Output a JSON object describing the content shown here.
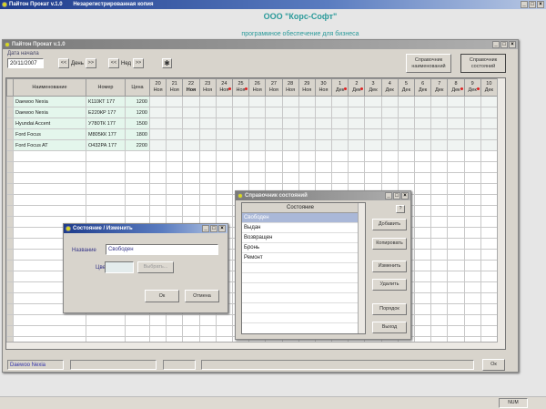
{
  "app": {
    "title": "Пайтон Прокат v.1.0",
    "subtitle": "Незарегистрированная копия"
  },
  "company": {
    "name": "ООО \"Корс-Софт\"",
    "tagline": "программное обеспечение для бизнеса"
  },
  "inner": {
    "title": "Пайтон Прокат v.1.0",
    "date_label": "Дата начала",
    "date_value": "20/11/2007",
    "day_prev": "<<",
    "day_label": "День",
    "day_next": ">>",
    "week_prev": "<<",
    "week_label": "Нед",
    "week_next": ">>",
    "btn_names": "Справочник наименований",
    "btn_states": "Справочник состояний"
  },
  "grid": {
    "headers": [
      "Наименование",
      "Номер",
      "Цена"
    ],
    "days": [
      {
        "d": "20",
        "m": "Ноя"
      },
      {
        "d": "21",
        "m": "Ноя"
      },
      {
        "d": "22",
        "m": "Ноя"
      },
      {
        "d": "23",
        "m": "Ноя"
      },
      {
        "d": "24",
        "m": "Ноя",
        "h": 1
      },
      {
        "d": "25",
        "m": "Ноя",
        "h": 1
      },
      {
        "d": "26",
        "m": "Ноя"
      },
      {
        "d": "27",
        "m": "Ноя"
      },
      {
        "d": "28",
        "m": "Ноя"
      },
      {
        "d": "29",
        "m": "Ноя"
      },
      {
        "d": "30",
        "m": "Ноя"
      },
      {
        "d": "1",
        "m": "Дек",
        "h": 1
      },
      {
        "d": "2",
        "m": "Дек",
        "h": 1
      },
      {
        "d": "3",
        "m": "Дек"
      },
      {
        "d": "4",
        "m": "Дек"
      },
      {
        "d": "5",
        "m": "Дек"
      },
      {
        "d": "6",
        "m": "Дек"
      },
      {
        "d": "7",
        "m": "Дек"
      },
      {
        "d": "8",
        "m": "Дек",
        "h": 1
      },
      {
        "d": "9",
        "m": "Дек",
        "h": 1
      },
      {
        "d": "10",
        "m": "Дек"
      }
    ],
    "rows": [
      [
        "Daewoo Nexia",
        "К110КТ 177",
        "1200"
      ],
      [
        "Daewoo Nexia",
        "Е220КР 177",
        "1200"
      ],
      [
        "Hyundai Accent",
        "У780ТК 177",
        "1500"
      ],
      [
        "Ford Focus",
        "М805КК 177",
        "1800"
      ],
      [
        "Ford Focus AT",
        "О432РА 177",
        "2200"
      ]
    ]
  },
  "status": {
    "selected": "Daewoo Nexia",
    "ok": "Ок",
    "num": "NUM"
  },
  "edit_dialog": {
    "title": "Состояние / Изменить",
    "name_label": "Название",
    "name_value": "Свободен",
    "color_label": "Цвет",
    "choose": "Выбрать...",
    "ok": "Ок",
    "cancel": "Отмена"
  },
  "states_dialog": {
    "title": "Справочник состояний",
    "column": "Состояние",
    "items": [
      "Свободен",
      "Выдан",
      "Возвращен",
      "Бронь",
      "Ремонт"
    ],
    "buttons": [
      "Добавить",
      "Копировать",
      "Изменить",
      "Удалить",
      "Порядок",
      "Выход"
    ]
  },
  "colors": {
    "accent": "#2a9a9a",
    "row_bg": "#e4f6ec",
    "selected": "#aab8d8"
  }
}
